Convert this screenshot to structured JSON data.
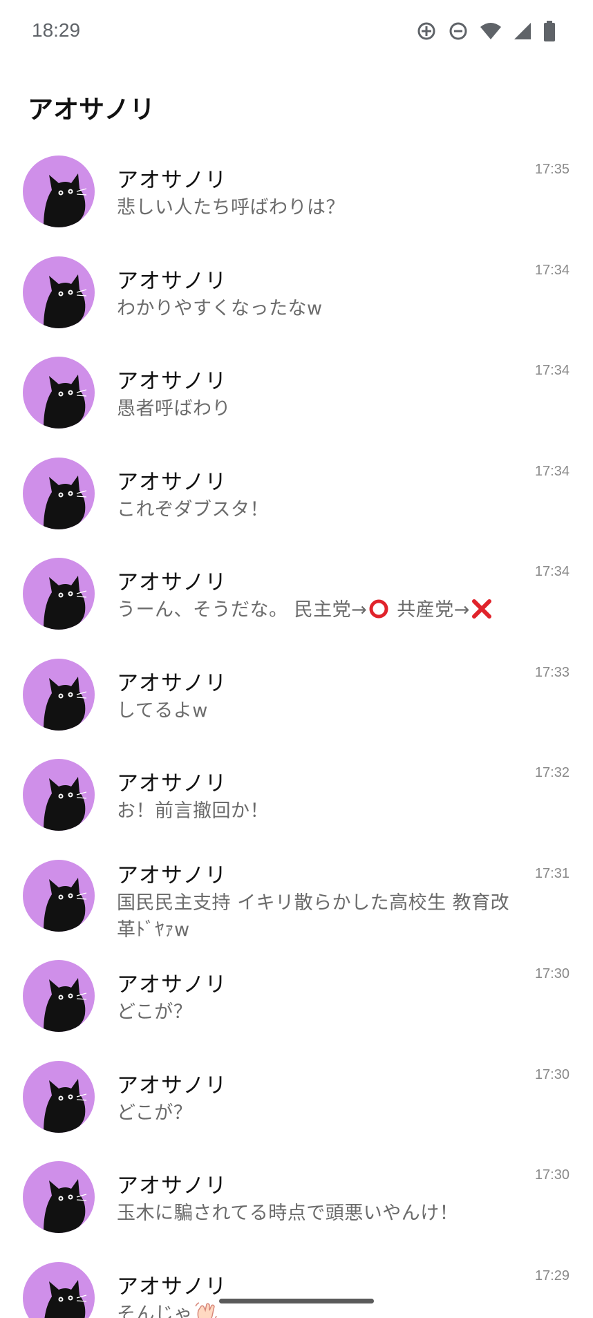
{
  "status_bar": {
    "time": "18:29",
    "icons": [
      "data-saver-icon",
      "do-not-disturb-icon",
      "wifi-icon",
      "signal-icon",
      "battery-icon"
    ]
  },
  "header": {
    "title": "アオサノリ"
  },
  "colors": {
    "avatar_bg": "#cf8fe9",
    "cat": "#111111",
    "circle_emoji": "#e0232b",
    "cross_emoji": "#e0232b"
  },
  "notifications": [
    {
      "sender": "アオサノリ",
      "message": "悲しい人たち呼ばわりは？",
      "time": "17:35"
    },
    {
      "sender": "アオサノリ",
      "message": "わかりやすくなったなw",
      "time": "17:34"
    },
    {
      "sender": "アオサノリ",
      "message": "愚者呼ばわり",
      "time": "17:34"
    },
    {
      "sender": "アオサノリ",
      "message": "これぞダブスタ！",
      "time": "17:34"
    },
    {
      "sender": "アオサノリ",
      "message_parts": [
        "うーん、そうだな。 民主党→",
        " 共産党→",
        ""
      ],
      "emojis": [
        "heavy-large-circle-icon",
        "cross-mark-icon"
      ],
      "time": "17:34"
    },
    {
      "sender": "アオサノリ",
      "message": "してるよw",
      "time": "17:33"
    },
    {
      "sender": "アオサノリ",
      "message": "お！前言撤回か！",
      "time": "17:32"
    },
    {
      "sender": "アオサノリ",
      "message": "国民民主支持 イキリ散らかした高校生 教育改革ﾄﾞﾔｧw",
      "time": "17:31"
    },
    {
      "sender": "アオサノリ",
      "message": "どこが？",
      "time": "17:30"
    },
    {
      "sender": "アオサノリ",
      "message": "どこが？",
      "time": "17:30"
    },
    {
      "sender": "アオサノリ",
      "message": "玉木に騙されてる時点で頭悪いやんけ！",
      "time": "17:30"
    },
    {
      "sender": "アオサノリ",
      "message": "そんじゃ",
      "emoji": "waving-hand-icon",
      "time": "17:29"
    }
  ]
}
